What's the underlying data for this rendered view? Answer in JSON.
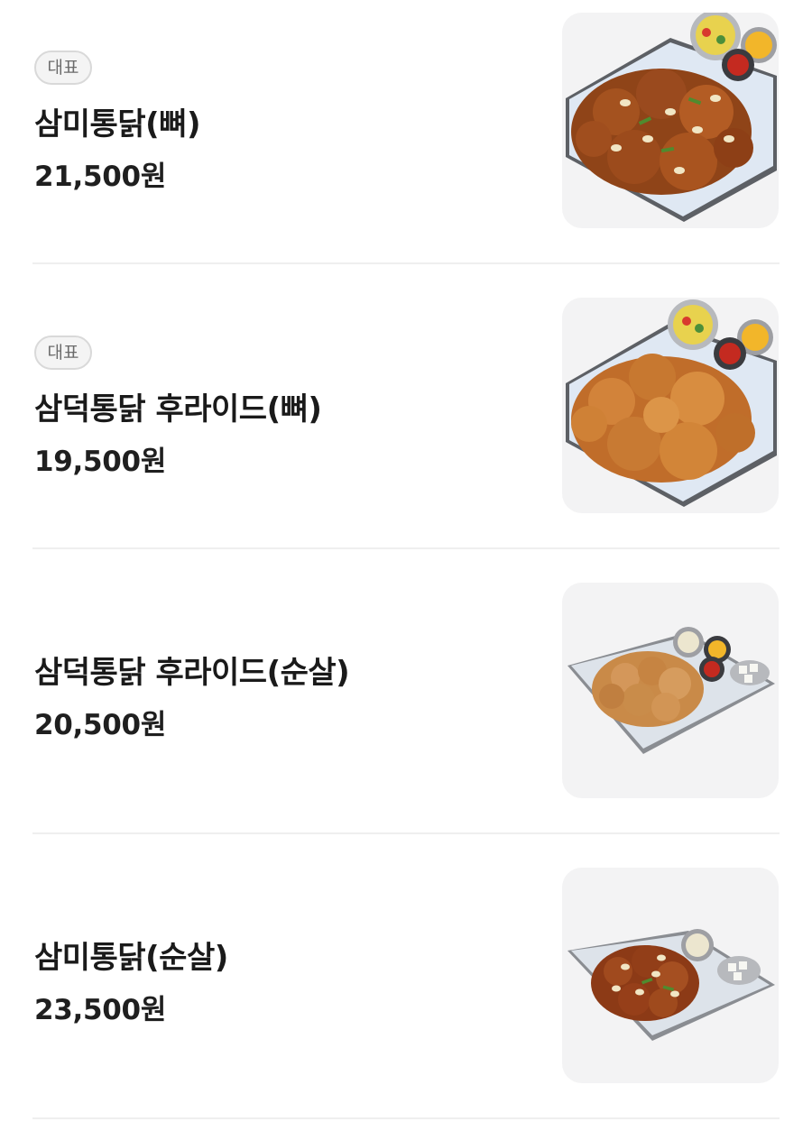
{
  "menu": {
    "items": [
      {
        "badge": "대표",
        "name": "삼미통닭(뼈)",
        "price": "21,500원",
        "image_icon": "yangnyeom-chicken-bone-tray-image"
      },
      {
        "badge": "대표",
        "name": "삼덕통닭 후라이드(뼈)",
        "price": "19,500원",
        "image_icon": "fried-chicken-bone-tray-image"
      },
      {
        "name": "삼덕통닭 후라이드(순살)",
        "price": "20,500원",
        "image_icon": "fried-chicken-boneless-tray-image"
      },
      {
        "name": "삼미통닭(순살)",
        "price": "23,500원",
        "image_icon": "yangnyeom-chicken-boneless-tray-image"
      }
    ]
  },
  "colors": {
    "text": "#1a1a1a",
    "badge_border": "#d9d9d9",
    "badge_text": "#6b6b6b",
    "divider": "#efefef",
    "image_bg": "#f3f3f4",
    "yangnyeom_chicken": "#9a4a1e",
    "fried_chicken": "#c8762f"
  }
}
